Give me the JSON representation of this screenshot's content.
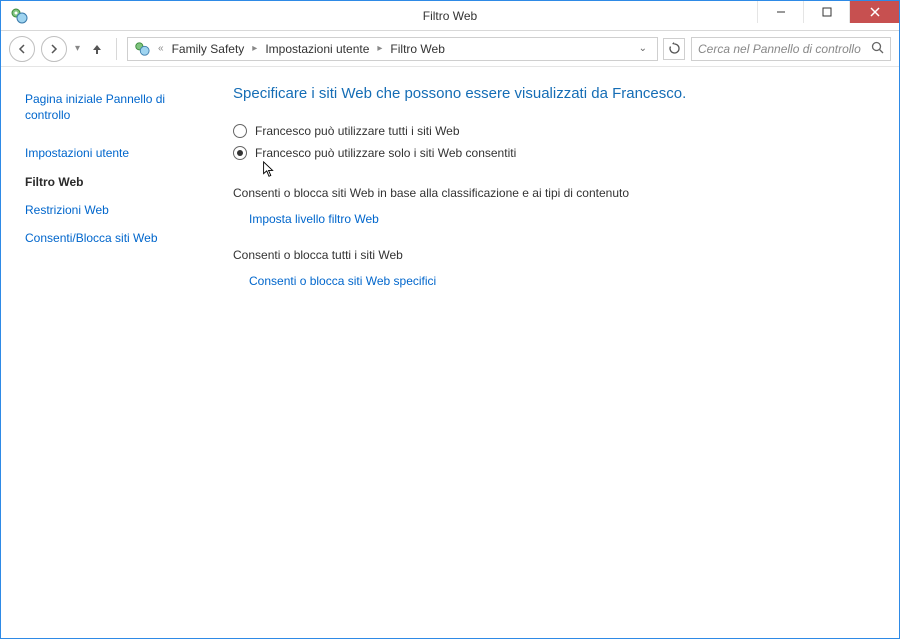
{
  "window": {
    "title": "Filtro Web"
  },
  "breadcrumb": {
    "prefix": "«",
    "items": [
      "Family Safety",
      "Impostazioni utente",
      "Filtro Web"
    ]
  },
  "search": {
    "placeholder": "Cerca nel Pannello di controllo"
  },
  "sidebar": {
    "items": [
      {
        "label": "Pagina iniziale Pannello di controllo",
        "bold": false
      },
      {
        "label": "Impostazioni utente",
        "bold": false
      },
      {
        "label": "Filtro Web",
        "bold": true
      },
      {
        "label": "Restrizioni Web",
        "bold": false
      },
      {
        "label": "Consenti/Blocca siti Web",
        "bold": false
      }
    ]
  },
  "main": {
    "heading": "Specificare i siti Web che possono essere visualizzati da Francesco.",
    "radio1": "Francesco può utilizzare tutti i siti Web",
    "radio2": "Francesco può utilizzare solo i siti Web consentiti",
    "section1": "Consenti o blocca siti Web in base alla classificazione e ai tipi di contenuto",
    "link1": "Imposta livello filtro Web",
    "section2": "Consenti o blocca tutti i siti Web",
    "link2": "Consenti o blocca siti Web specifici"
  }
}
